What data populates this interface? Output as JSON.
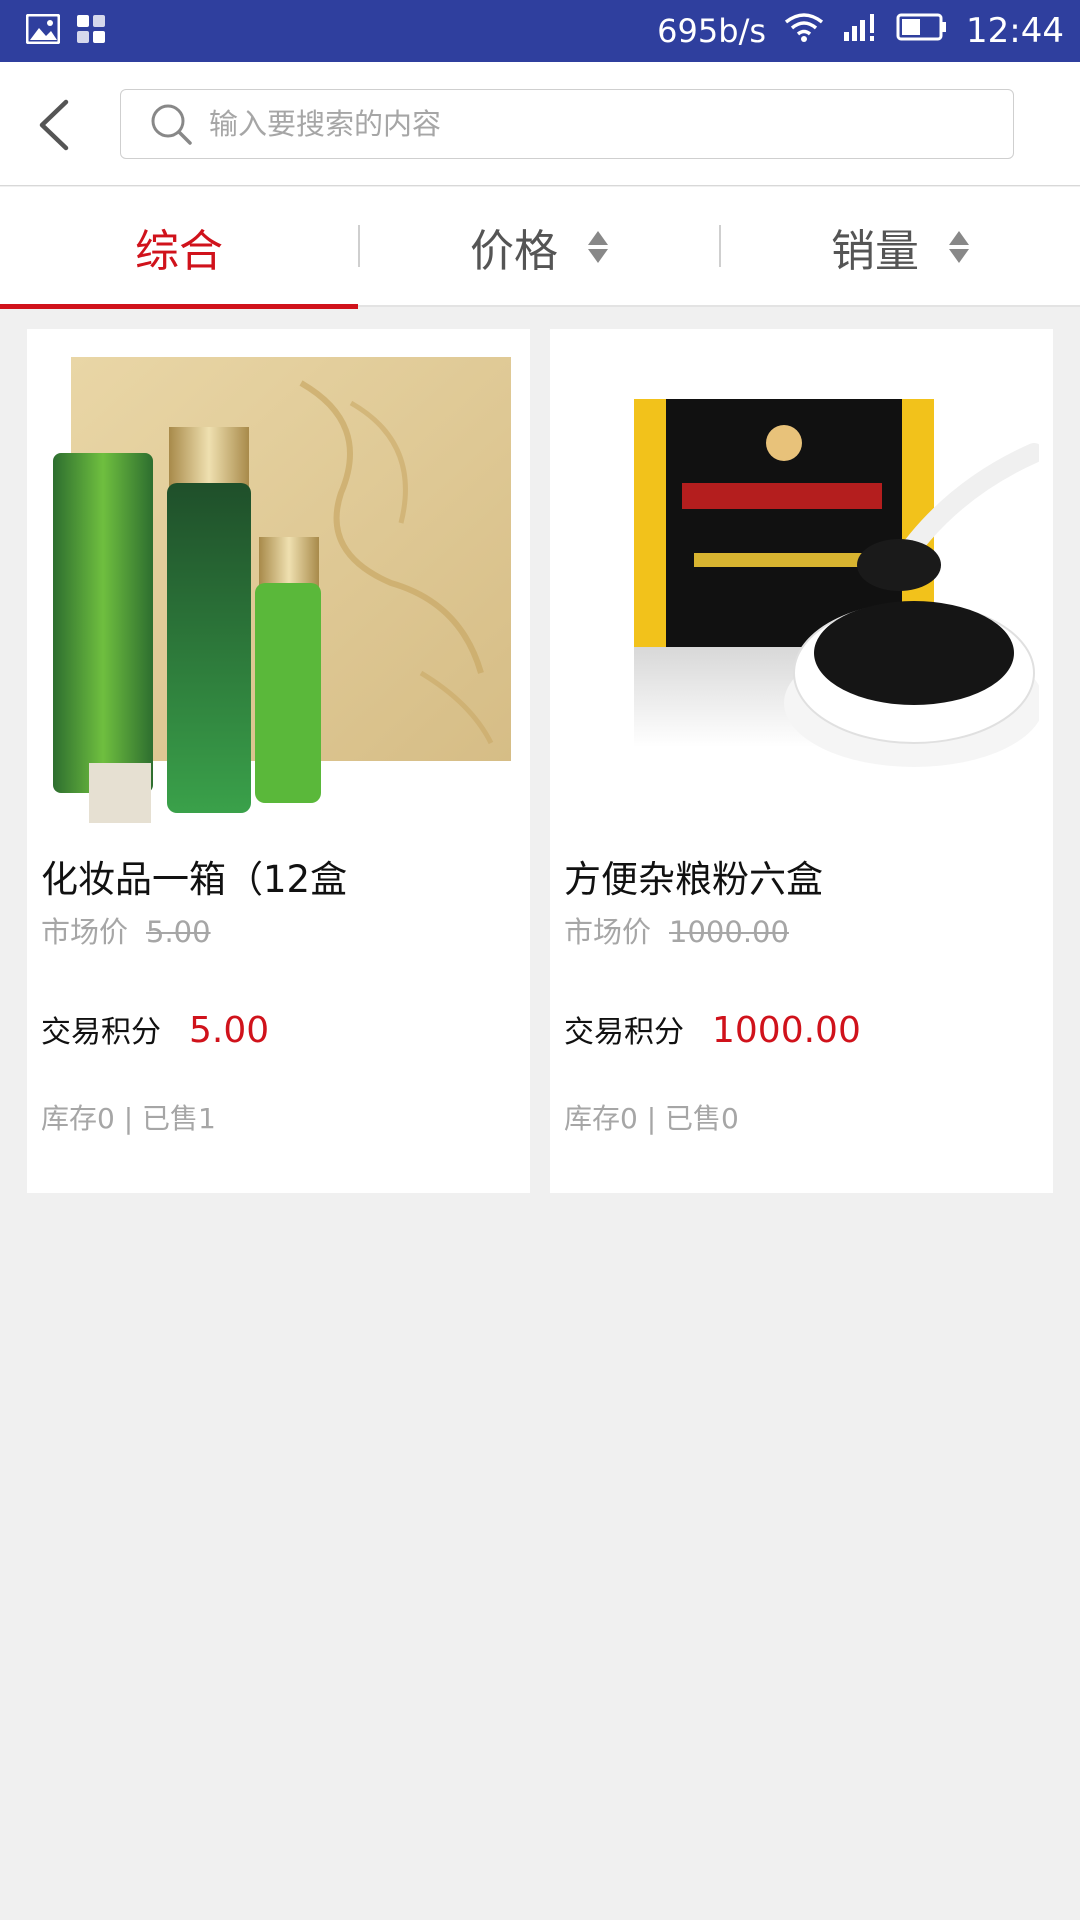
{
  "status_bar": {
    "speed": "695b/s",
    "time": "12:44",
    "bg_color": "#2f3f9e",
    "battery_level": 0.5
  },
  "header": {
    "search_placeholder": "输入要搜索的内容"
  },
  "sort_tabs": [
    {
      "label": "综合",
      "active": true
    },
    {
      "label": "价格",
      "active": false
    },
    {
      "label": "销量",
      "active": false
    }
  ],
  "products": [
    {
      "title": "化妆品一箱（12盒",
      "market_label": "市场价",
      "market_price": "5.00",
      "points_label": "交易积分",
      "points_value": "5.00",
      "stock_text": "库存0 | 已售1"
    },
    {
      "title": "方便杂粮粉六盒",
      "market_label": "市场价",
      "market_price": "1000.00",
      "points_label": "交易积分",
      "points_value": "1000.00",
      "stock_text": "库存0 | 已售0"
    }
  ],
  "colors": {
    "accent": "#d0121b",
    "page_bg": "#f0f0f0"
  }
}
